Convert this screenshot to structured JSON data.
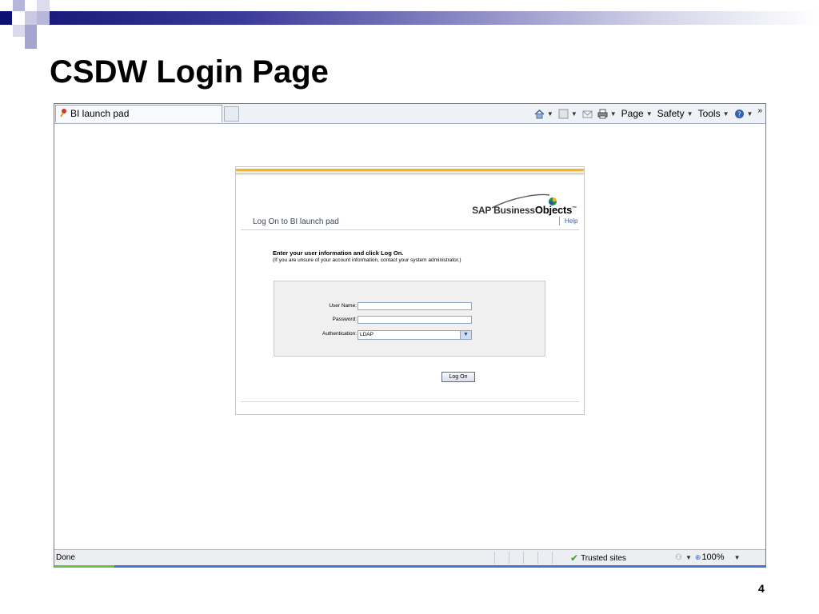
{
  "slide": {
    "title": "CSDW Login Page",
    "page_number": "4",
    "accent_color": "#1a1a7a"
  },
  "browser": {
    "tab_title": "BI launch pad",
    "tab_icon": "sap-favicon-icon",
    "commands": {
      "home_icon": "home-icon",
      "feeds_icon": "feeds-icon",
      "mail_icon": "mail-icon",
      "print_icon": "print-icon",
      "page_label": "Page",
      "safety_label": "Safety",
      "tools_label": "Tools",
      "help_icon": "help-icon",
      "overflow": "»"
    },
    "status": {
      "text": "Done",
      "zone": "Trusted sites",
      "zoom": "100%"
    }
  },
  "login": {
    "logo_prefix": "SAP Business",
    "logo_bold": "Objects",
    "logo_tm": "™",
    "heading": "Log On to BI launch pad",
    "help_label": "Help",
    "instruction": "Enter your user information and click Log On.",
    "instruction_sub": "(If you are unsure of your account information, contact your system administrator.)",
    "fields": {
      "username_label": "User Name:",
      "username_value": "",
      "password_label": "Password:",
      "password_value": "",
      "auth_label": "Authentication:",
      "auth_value": "LDAP"
    },
    "logon_button": "Log On",
    "stripe_color": "#f6b52a"
  }
}
